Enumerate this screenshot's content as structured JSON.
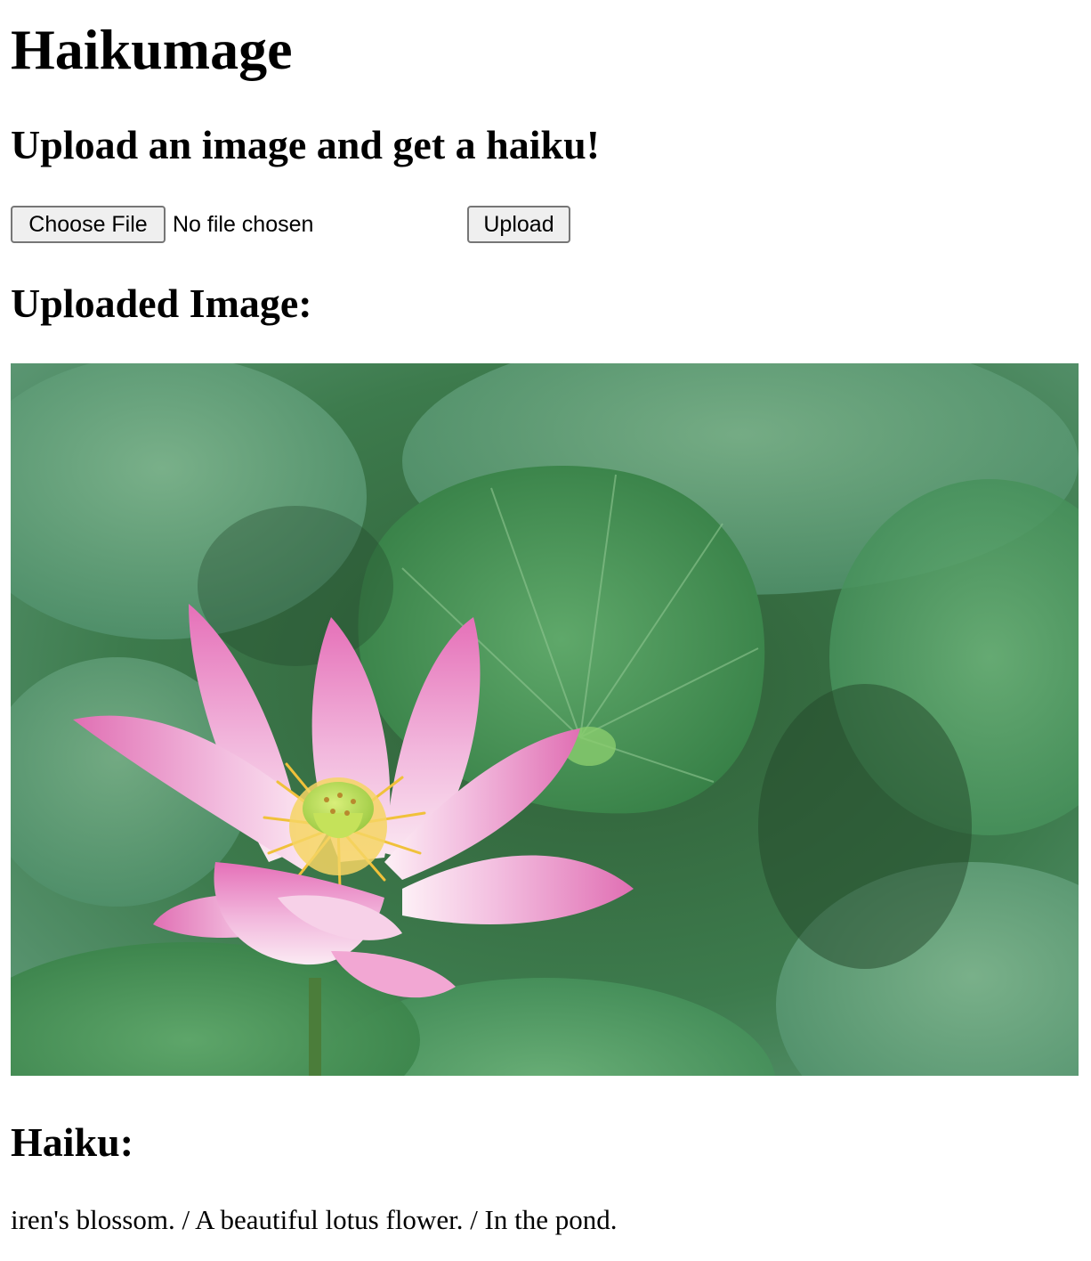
{
  "app": {
    "title": "Haikumage",
    "subtitle": "Upload an image and get a haiku!"
  },
  "upload_form": {
    "choose_file_label": "Choose File",
    "file_status": "No file chosen",
    "upload_label": "Upload"
  },
  "uploaded_image": {
    "heading": "Uploaded Image:",
    "icon": "lotus-flower-photo"
  },
  "haiku": {
    "heading": "Haiku:",
    "text": "iren's blossom. / A beautiful lotus flower. / In the pond."
  },
  "colors": {
    "background": "#ffffff",
    "text": "#000000",
    "button_bg": "#efefef",
    "button_border": "#767676",
    "leaf_green": "#4f9a62",
    "petal_pink": "#e98dc8"
  }
}
